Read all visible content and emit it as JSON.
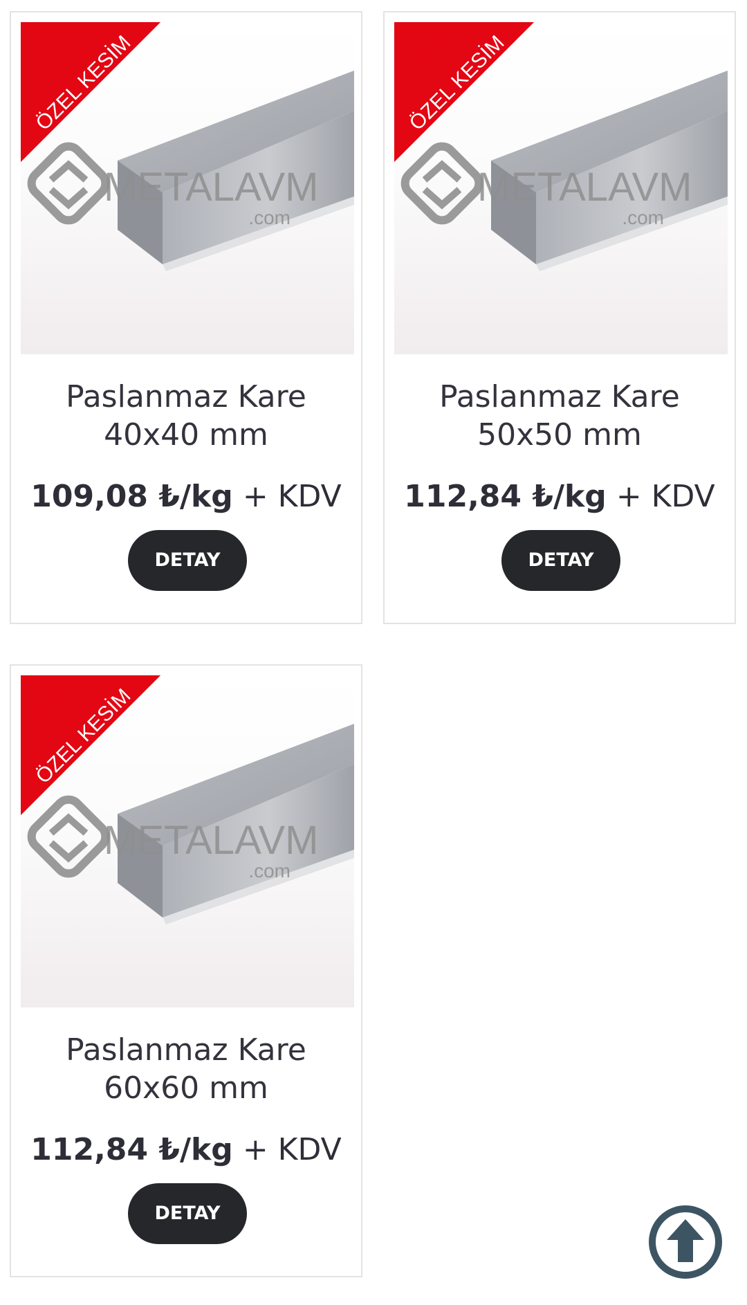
{
  "products": [
    {
      "badge": "ÖZEL KESİM",
      "watermark": "METALAVM",
      "watermark_suffix": ".com",
      "title_line1": "Paslanmaz Kare",
      "title_line2": "40x40 mm",
      "price": "109,08 ₺/kg",
      "tax": "+ KDV",
      "button_label": "DETAY"
    },
    {
      "badge": "ÖZEL KESİM",
      "watermark": "METALAVM",
      "watermark_suffix": ".com",
      "title_line1": "Paslanmaz Kare",
      "title_line2": "50x50 mm",
      "price": "112,84 ₺/kg",
      "tax": "+ KDV",
      "button_label": "DETAY"
    },
    {
      "badge": "ÖZEL KESİM",
      "watermark": "METALAVM",
      "watermark_suffix": ".com",
      "title_line1": "Paslanmaz Kare",
      "title_line2": "60x60 mm",
      "price": "112,84 ₺/kg",
      "tax": "+ KDV",
      "button_label": "DETAY"
    }
  ],
  "colors": {
    "badge": "#e30613",
    "button": "#26272b",
    "scroll_top": "#3d5563",
    "text": "#2e2e38"
  },
  "icons": {
    "scroll_top": "arrow-up-circle-icon",
    "watermark_logo": "metalavm-logo-icon"
  }
}
